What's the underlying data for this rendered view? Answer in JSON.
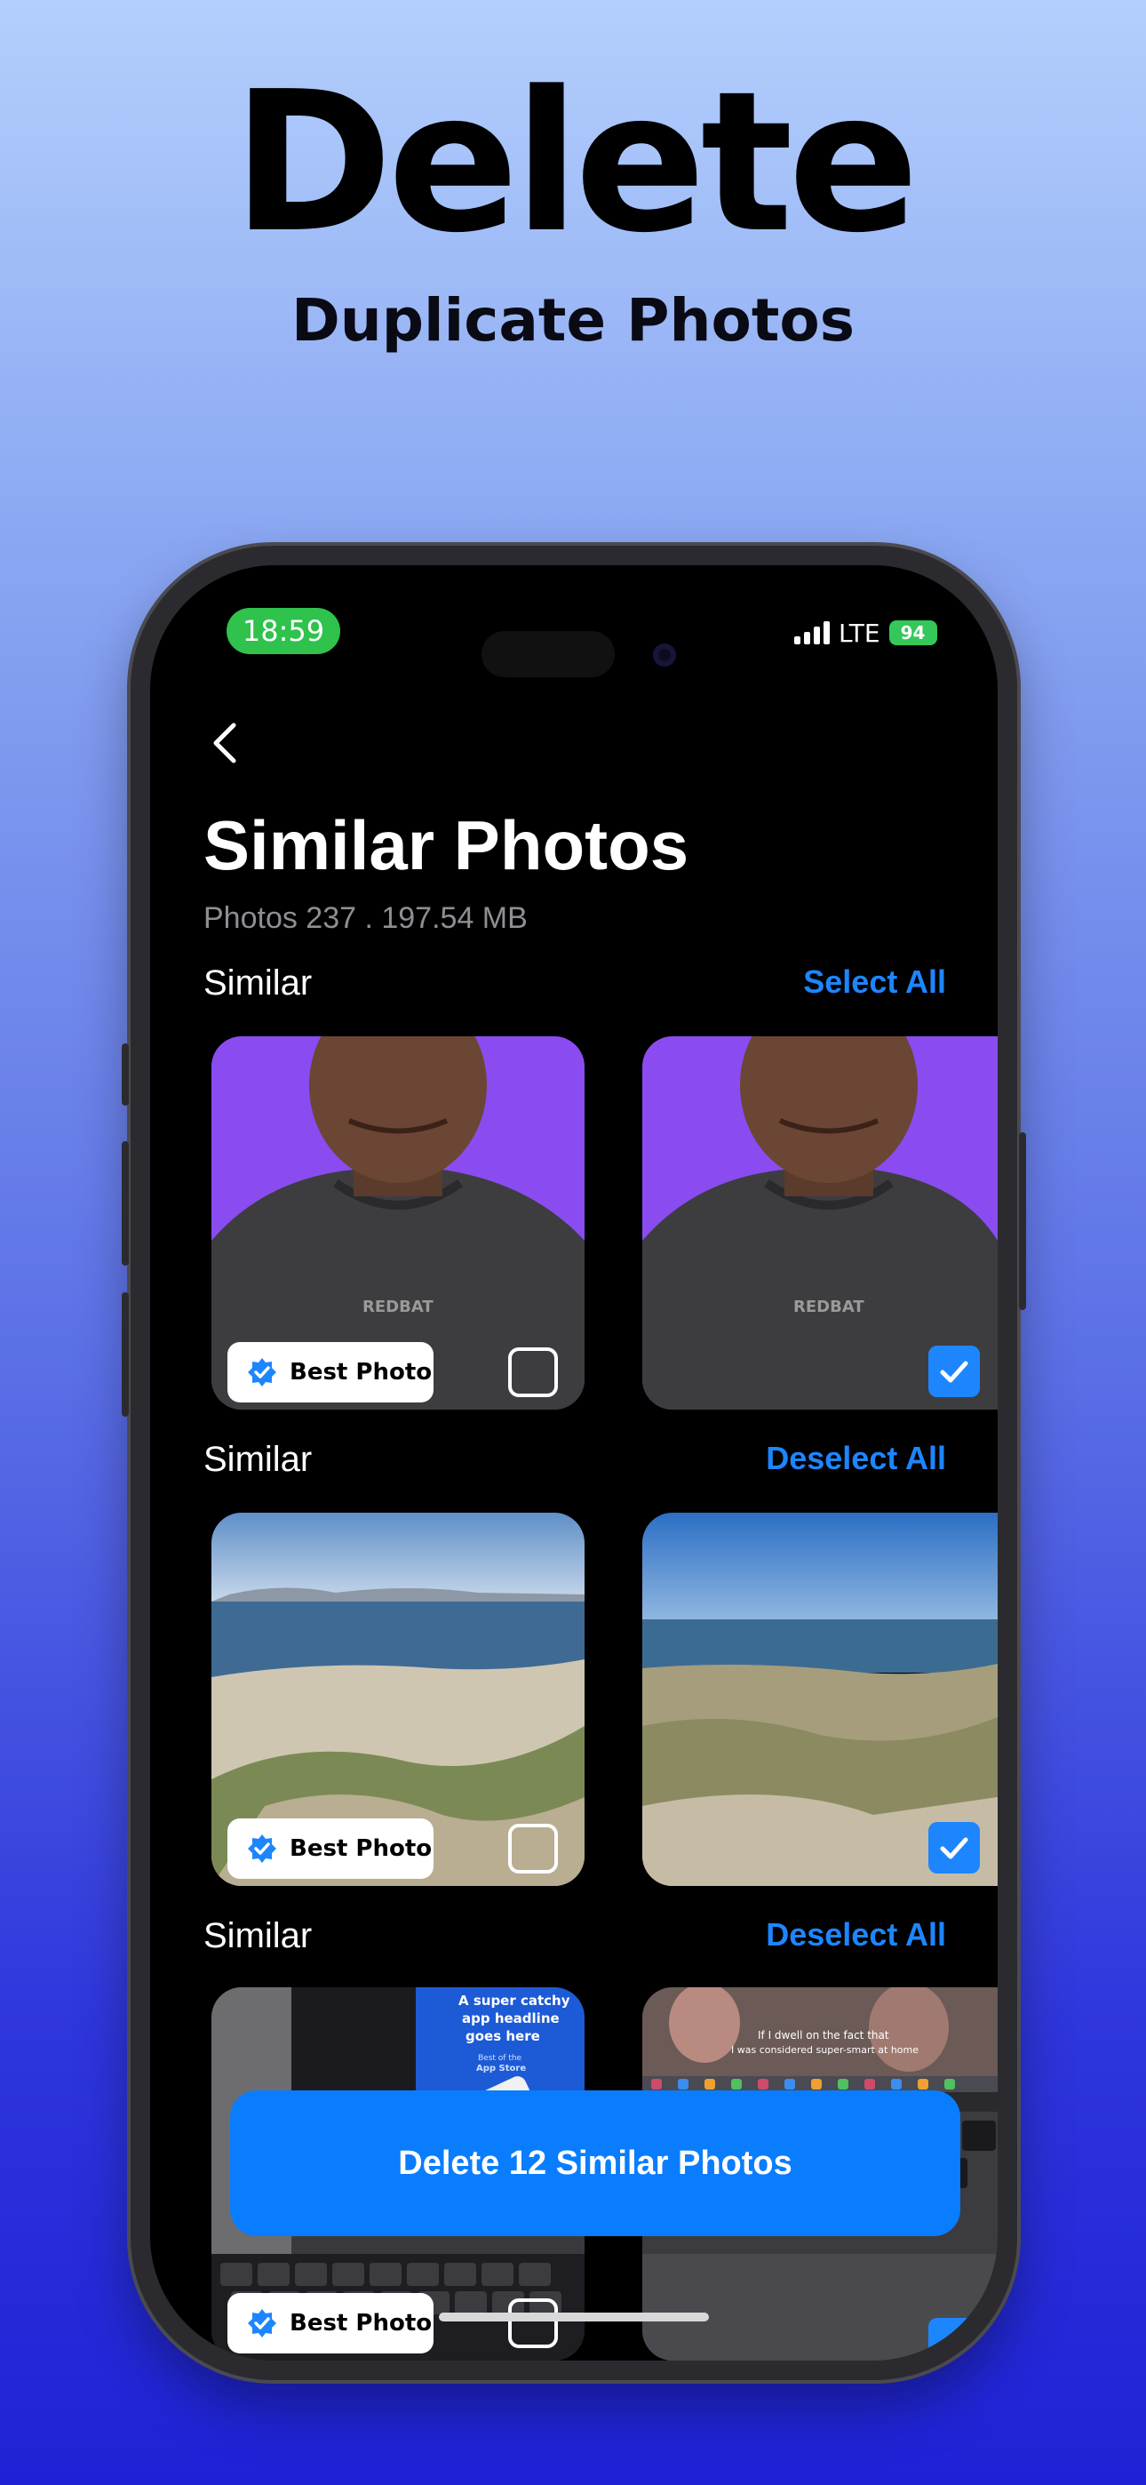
{
  "hero": {
    "title": "Delete",
    "subtitle": "Duplicate Photos"
  },
  "status_bar": {
    "time": "18:59",
    "network": "LTE",
    "battery": "94"
  },
  "header": {
    "title": "Similar Photos",
    "subtitle": "Photos 237 . 197.54 MB"
  },
  "groups": [
    {
      "label": "Similar",
      "action": "Select All",
      "best_label": "Best Photo"
    },
    {
      "label": "Similar",
      "action": "Deselect All",
      "best_label": "Best Photo"
    },
    {
      "label": "Similar",
      "action": "Deselect All",
      "best_label": "Best Photo"
    }
  ],
  "photo_text": {
    "shirt_print": "REDBAT",
    "laptop_screen_lines": [
      "A super catchy",
      "app headline",
      "goes here"
    ],
    "laptop_screen_badge": [
      "Best of the",
      "App Store"
    ],
    "video_caption": [
      "If I dwell on the fact that",
      "I was considered super-smart at home"
    ]
  },
  "delete_button": {
    "label": "Delete 12 Similar Photos"
  },
  "colors": {
    "accent": "#0a7dff",
    "link": "#1d86ff",
    "time_pill": "#2fc24c",
    "battery": "#34c759"
  }
}
